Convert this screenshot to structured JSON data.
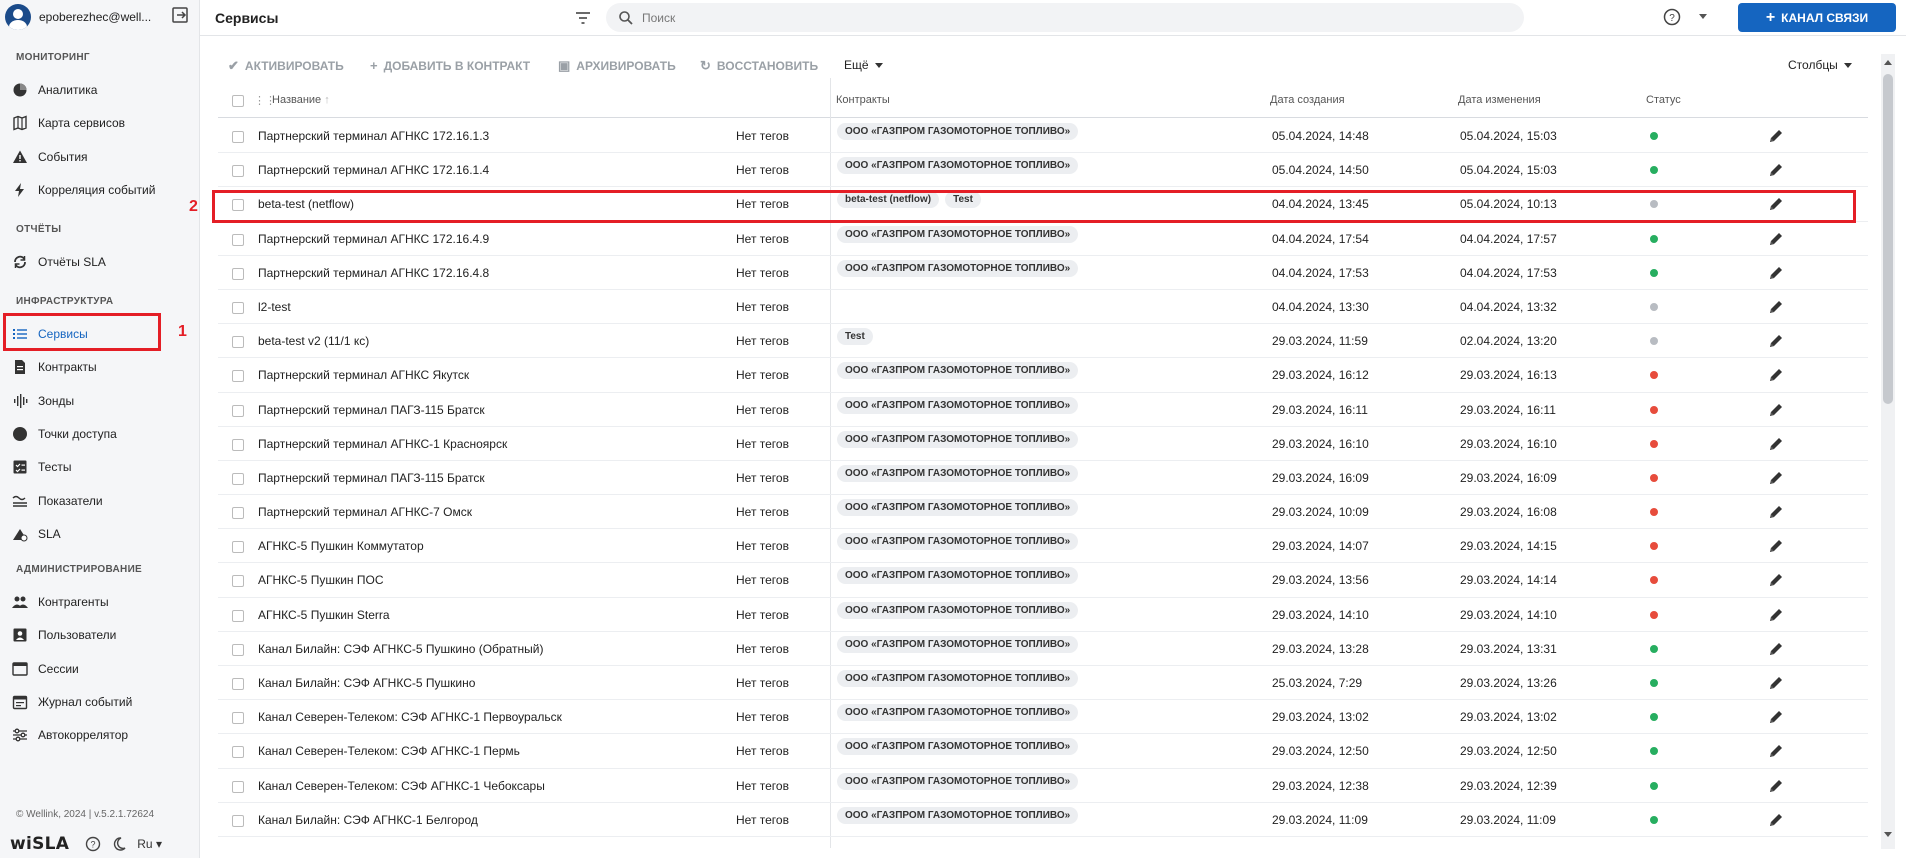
{
  "user": {
    "name": "epoberezhec@well..."
  },
  "sidebar": {
    "sections": [
      {
        "title": "МОНИТОРИНГ",
        "items": [
          {
            "label": "Аналитика",
            "icon": "pie-chart-icon"
          },
          {
            "label": "Карта сервисов",
            "icon": "map-icon"
          },
          {
            "label": "События",
            "icon": "warning-icon"
          },
          {
            "label": "Корреляция событий",
            "icon": "bolt-icon"
          }
        ]
      },
      {
        "title": "ОТЧЁТЫ",
        "items": [
          {
            "label": "Отчёты SLA",
            "icon": "sync-icon"
          }
        ]
      },
      {
        "title": "ИНФРАСТРУКТУРА",
        "items": [
          {
            "label": "Сервисы",
            "icon": "list-icon",
            "active": true
          },
          {
            "label": "Контракты",
            "icon": "document-icon"
          },
          {
            "label": "Зонды",
            "icon": "probe-icon"
          },
          {
            "label": "Точки доступа",
            "icon": "circle-icon"
          },
          {
            "label": "Тесты",
            "icon": "checklist-icon"
          },
          {
            "label": "Показатели",
            "icon": "metrics-icon"
          },
          {
            "label": "SLA",
            "icon": "sla-icon"
          }
        ]
      },
      {
        "title": "АДМИНИСТРИРОВАНИЕ",
        "items": [
          {
            "label": "Контрагенты",
            "icon": "people-icon"
          },
          {
            "label": "Пользователи",
            "icon": "user-card-icon"
          },
          {
            "label": "Сессии",
            "icon": "browser-icon"
          },
          {
            "label": "Журнал событий",
            "icon": "calendar-icon"
          },
          {
            "label": "Автокоррелятор",
            "icon": "sliders-icon"
          }
        ]
      }
    ],
    "copyright": "© Wellink, 2024 | v.5.2.1.72624",
    "logo": "wiSLA",
    "lang": "Ru"
  },
  "header": {
    "title": "Сервисы",
    "search_placeholder": "Поиск",
    "channel_button": "КАНАЛ СВЯЗИ"
  },
  "toolbar": {
    "activate": "АКТИВИРОВАТЬ",
    "add_to_contract": "ДОБАВИТЬ В КОНТРАКТ",
    "archive": "АРХИВИРОВАТЬ",
    "restore": "ВОССТАНОВИТЬ",
    "more": "Ещё",
    "columns": "Столбцы"
  },
  "annotations": {
    "label1": "1",
    "label2": "2"
  },
  "table": {
    "headers": {
      "name": "Название",
      "contracts": "Контракты",
      "created": "Дата создания",
      "modified": "Дата изменения",
      "status": "Статус"
    },
    "status_colors": {
      "green": "#27ae60",
      "gray": "#b8bcc2",
      "red": "#e74c3c"
    },
    "rows": [
      {
        "name": "Партнерский терминал АГНКС 172.16.1.3",
        "tags": "Нет тегов",
        "contracts": [
          "ООО «ГАЗПРОМ ГАЗОМОТОРНОЕ ТОПЛИВО»"
        ],
        "created": "05.04.2024, 14:48",
        "modified": "05.04.2024, 15:03",
        "status": "green"
      },
      {
        "name": "Партнерский терминал АГНКС 172.16.1.4",
        "tags": "Нет тегов",
        "contracts": [
          "ООО «ГАЗПРОМ ГАЗОМОТОРНОЕ ТОПЛИВО»"
        ],
        "created": "05.04.2024, 14:50",
        "modified": "05.04.2024, 15:03",
        "status": "green"
      },
      {
        "name": "beta-test (netflow)",
        "tags": "Нет тегов",
        "contracts": [
          "beta-test (netflow)",
          "Test"
        ],
        "created": "04.04.2024, 13:45",
        "modified": "05.04.2024, 10:13",
        "status": "gray"
      },
      {
        "name": "Партнерский терминал АГНКС 172.16.4.9",
        "tags": "Нет тегов",
        "contracts": [
          "ООО «ГАЗПРОМ ГАЗОМОТОРНОЕ ТОПЛИВО»"
        ],
        "created": "04.04.2024, 17:54",
        "modified": "04.04.2024, 17:57",
        "status": "green"
      },
      {
        "name": "Партнерский терминал АГНКС 172.16.4.8",
        "tags": "Нет тегов",
        "contracts": [
          "ООО «ГАЗПРОМ ГАЗОМОТОРНОЕ ТОПЛИВО»"
        ],
        "created": "04.04.2024, 17:53",
        "modified": "04.04.2024, 17:53",
        "status": "green"
      },
      {
        "name": "l2-test",
        "tags": "Нет тегов",
        "contracts": [],
        "created": "04.04.2024, 13:30",
        "modified": "04.04.2024, 13:32",
        "status": "gray"
      },
      {
        "name": "beta-test v2 (11/1 кс)",
        "tags": "Нет тегов",
        "contracts": [
          "Test"
        ],
        "created": "29.03.2024, 11:59",
        "modified": "02.04.2024, 13:20",
        "status": "gray"
      },
      {
        "name": "Партнерский терминал АГНКС Якутск",
        "tags": "Нет тегов",
        "contracts": [
          "ООО «ГАЗПРОМ ГАЗОМОТОРНОЕ ТОПЛИВО»"
        ],
        "created": "29.03.2024, 16:12",
        "modified": "29.03.2024, 16:13",
        "status": "red"
      },
      {
        "name": "Партнерский терминал ПАГЗ-115 Братск",
        "tags": "Нет тегов",
        "contracts": [
          "ООО «ГАЗПРОМ ГАЗОМОТОРНОЕ ТОПЛИВО»"
        ],
        "created": "29.03.2024, 16:11",
        "modified": "29.03.2024, 16:11",
        "status": "red"
      },
      {
        "name": "Партнерский терминал АГНКС-1 Красноярск",
        "tags": "Нет тегов",
        "contracts": [
          "ООО «ГАЗПРОМ ГАЗОМОТОРНОЕ ТОПЛИВО»"
        ],
        "created": "29.03.2024, 16:10",
        "modified": "29.03.2024, 16:10",
        "status": "red"
      },
      {
        "name": "Партнерский терминал ПАГЗ-115 Братск",
        "tags": "Нет тегов",
        "contracts": [
          "ООО «ГАЗПРОМ ГАЗОМОТОРНОЕ ТОПЛИВО»"
        ],
        "created": "29.03.2024, 16:09",
        "modified": "29.03.2024, 16:09",
        "status": "red"
      },
      {
        "name": "Партнерский терминал АГНКС-7 Омск",
        "tags": "Нет тегов",
        "contracts": [
          "ООО «ГАЗПРОМ ГАЗОМОТОРНОЕ ТОПЛИВО»"
        ],
        "created": "29.03.2024, 10:09",
        "modified": "29.03.2024, 16:08",
        "status": "red"
      },
      {
        "name": "АГНКС-5 Пушкин Коммутатор",
        "tags": "Нет тегов",
        "contracts": [
          "ООО «ГАЗПРОМ ГАЗОМОТОРНОЕ ТОПЛИВО»"
        ],
        "created": "29.03.2024, 14:07",
        "modified": "29.03.2024, 14:15",
        "status": "red"
      },
      {
        "name": "АГНКС-5 Пушкин ПОС",
        "tags": "Нет тегов",
        "contracts": [
          "ООО «ГАЗПРОМ ГАЗОМОТОРНОЕ ТОПЛИВО»"
        ],
        "created": "29.03.2024, 13:56",
        "modified": "29.03.2024, 14:14",
        "status": "red"
      },
      {
        "name": "АГНКС-5 Пушкин Sterra",
        "tags": "Нет тегов",
        "contracts": [
          "ООО «ГАЗПРОМ ГАЗОМОТОРНОЕ ТОПЛИВО»"
        ],
        "created": "29.03.2024, 14:10",
        "modified": "29.03.2024, 14:10",
        "status": "red"
      },
      {
        "name": "Канал Билайн: СЭФ АГНКС-5 Пушкино (Обратный)",
        "tags": "Нет тегов",
        "contracts": [
          "ООО «ГАЗПРОМ ГАЗОМОТОРНОЕ ТОПЛИВО»"
        ],
        "created": "29.03.2024, 13:28",
        "modified": "29.03.2024, 13:31",
        "status": "green"
      },
      {
        "name": "Канал Билайн: СЭФ АГНКС-5 Пушкино",
        "tags": "Нет тегов",
        "contracts": [
          "ООО «ГАЗПРОМ ГАЗОМОТОРНОЕ ТОПЛИВО»"
        ],
        "created": "25.03.2024, 7:29",
        "modified": "29.03.2024, 13:26",
        "status": "green"
      },
      {
        "name": "Канал Северен-Телеком: СЭФ АГНКС-1 Первоуральск",
        "tags": "Нет тегов",
        "contracts": [
          "ООО «ГАЗПРОМ ГАЗОМОТОРНОЕ ТОПЛИВО»"
        ],
        "created": "29.03.2024, 13:02",
        "modified": "29.03.2024, 13:02",
        "status": "green"
      },
      {
        "name": "Канал Северен-Телеком: СЭФ АГНКС-1 Пермь",
        "tags": "Нет тегов",
        "contracts": [
          "ООО «ГАЗПРОМ ГАЗОМОТОРНОЕ ТОПЛИВО»"
        ],
        "created": "29.03.2024, 12:50",
        "modified": "29.03.2024, 12:50",
        "status": "green"
      },
      {
        "name": "Канал Северен-Телеком: СЭФ АГНКС-1 Чебоксары",
        "tags": "Нет тегов",
        "contracts": [
          "ООО «ГАЗПРОМ ГАЗОМОТОРНОЕ ТОПЛИВО»"
        ],
        "created": "29.03.2024, 12:38",
        "modified": "29.03.2024, 12:39",
        "status": "green"
      },
      {
        "name": "Канал Билайн: СЭФ АГНКС-1 Белгород",
        "tags": "Нет тегов",
        "contracts": [
          "ООО «ГАЗПРОМ ГАЗОМОТОРНОЕ ТОПЛИВО»"
        ],
        "created": "29.03.2024, 11:09",
        "modified": "29.03.2024, 11:09",
        "status": "green"
      }
    ]
  }
}
